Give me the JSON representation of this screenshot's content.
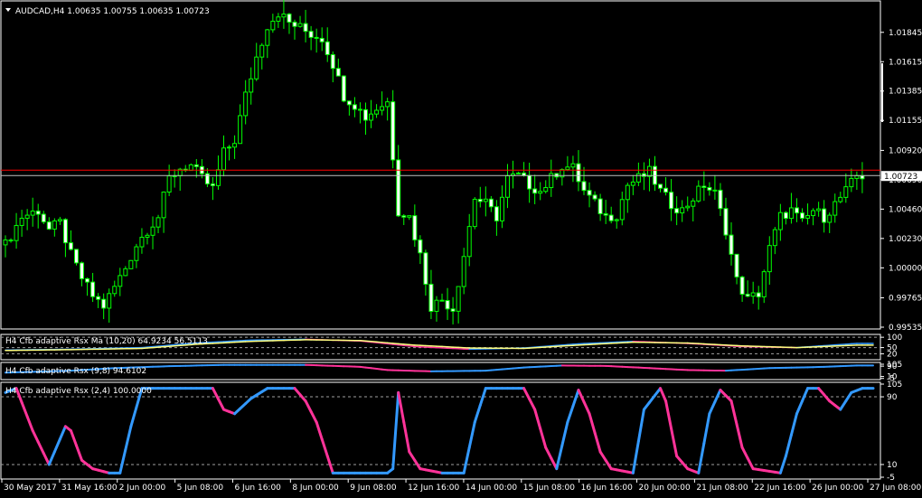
{
  "colors": {
    "background": "#000000",
    "frame": "#ffffff",
    "bull_wick": "#00ff00",
    "bear_wick": "#00ff00",
    "bull_body": "#000000",
    "bear_body": "#ffffff",
    "price_line": "#ff0000",
    "bid_line": "#c0c0c0",
    "rsx_up": "#3399ff",
    "rsx_down": "#ff3399",
    "ma_line": "#ffff80",
    "level_line": "#a0a0a0",
    "price_tag_bg": "#ffffff",
    "price_tag_fg": "#000000"
  },
  "header": {
    "symbol_title": "AUDCAD,H4  1.00635 1.00755 1.00635 1.00723",
    "menu_icon": "triangle-down-icon"
  },
  "chart_data": [
    {
      "type": "candlestick",
      "title": "AUDCAD,H4  1.00635 1.00755 1.00635 1.00723",
      "ylim": [
        0.99535,
        1.0207
      ],
      "y_ticks": [
        "1.01845",
        "1.01615",
        "1.01385",
        "1.01155",
        "1.00920",
        "1.00690",
        "1.00460",
        "1.00230",
        "1.00000",
        "0.99765",
        "0.99535"
      ],
      "y_tick_values": [
        1.01845,
        1.01615,
        1.01385,
        1.01155,
        1.0092,
        1.0069,
        1.0046,
        1.0023,
        1.0,
        0.99765,
        0.99535
      ],
      "current_price_label": "1.00723",
      "current_price": 1.00723,
      "x_tick_labels": [
        "30 May 2017",
        "31 May 16:00",
        "2 Jun 00:00",
        "5 Jun 08:00",
        "6 Jun 16:00",
        "8 Jun 00:00",
        "9 Jun 08:00",
        "12 Jun 16:00",
        "14 Jun 00:00",
        "15 Jun 08:00",
        "16 Jun 16:00",
        "20 Jun 00:00",
        "21 Jun 08:00",
        "22 Jun 16:00",
        "26 Jun 00:00",
        "27 Jun 08:00"
      ],
      "close_anchors": [
        [
          0,
          1.0018
        ],
        [
          3,
          1.004
        ],
        [
          6,
          1.0045
        ],
        [
          8,
          1.003
        ],
        [
          10,
          1.0035
        ],
        [
          12,
          1.001
        ],
        [
          14,
          0.9992
        ],
        [
          16,
          0.9978
        ],
        [
          18,
          0.997
        ],
        [
          20,
          0.9985
        ],
        [
          22,
          1.0
        ],
        [
          24,
          1.0018
        ],
        [
          26,
          1.003
        ],
        [
          28,
          1.004
        ],
        [
          30,
          1.007
        ],
        [
          32,
          1.0078
        ],
        [
          34,
          1.008
        ],
        [
          36,
          1.007
        ],
        [
          38,
          1.0062
        ],
        [
          40,
          1.009
        ],
        [
          42,
          1.01
        ],
        [
          44,
          1.0135
        ],
        [
          46,
          1.0165
        ],
        [
          48,
          1.019
        ],
        [
          50,
          1.02
        ],
        [
          52,
          1.0192
        ],
        [
          54,
          1.0188
        ],
        [
          56,
          1.0183
        ],
        [
          58,
          1.018
        ],
        [
          60,
          1.016
        ],
        [
          62,
          1.0135
        ],
        [
          64,
          1.0128
        ],
        [
          66,
          1.0118
        ],
        [
          68,
          1.0125
        ],
        [
          70,
          1.013
        ],
        [
          72,
          1.0045
        ],
        [
          74,
          1.004
        ],
        [
          76,
          1.001
        ],
        [
          78,
          0.997
        ],
        [
          80,
          0.9975
        ],
        [
          82,
          0.9968
        ],
        [
          84,
          1.001
        ],
        [
          86,
          1.0055
        ],
        [
          88,
          1.005
        ],
        [
          90,
          1.004
        ],
        [
          92,
          1.007
        ],
        [
          94,
          1.0072
        ],
        [
          96,
          1.0065
        ],
        [
          98,
          1.006
        ],
        [
          100,
          1.007
        ],
        [
          102,
          1.008
        ],
        [
          104,
          1.0078
        ],
        [
          106,
          1.006
        ],
        [
          108,
          1.005
        ],
        [
          110,
          1.004
        ],
        [
          112,
          1.0042
        ],
        [
          114,
          1.0065
        ],
        [
          116,
          1.007
        ],
        [
          118,
          1.0075
        ],
        [
          120,
          1.006
        ],
        [
          122,
          1.005
        ],
        [
          124,
          1.0045
        ],
        [
          126,
          1.0055
        ],
        [
          128,
          1.0065
        ],
        [
          130,
          1.0058
        ],
        [
          132,
          1.003
        ],
        [
          134,
          0.999
        ],
        [
          136,
          0.9975
        ],
        [
          138,
          0.998
        ],
        [
          140,
          1.0015
        ],
        [
          142,
          1.004
        ],
        [
          144,
          1.0045
        ],
        [
          146,
          1.0035
        ],
        [
          148,
          1.0045
        ],
        [
          150,
          1.004
        ],
        [
          152,
          1.005
        ],
        [
          154,
          1.006
        ],
        [
          156,
          1.0072
        ]
      ]
    },
    {
      "type": "line",
      "title": "H4 Cfb adaptive Rsx Ma (10,20) 64.9234 56.5113",
      "ylim": [
        0,
        105
      ],
      "y_ticks": [
        "100",
        "50",
        "20"
      ],
      "y_tick_values": [
        100,
        50,
        20
      ],
      "levels": [
        50,
        20,
        100
      ],
      "series": [
        {
          "name": "Rsx Ma fast",
          "anchors": [
            [
              0,
              38
            ],
            [
              12,
              42
            ],
            [
              25,
              50
            ],
            [
              35,
              72
            ],
            [
              45,
              86
            ],
            [
              55,
              90
            ],
            [
              65,
              82
            ],
            [
              75,
              55
            ],
            [
              85,
              42
            ],
            [
              95,
              48
            ],
            [
              105,
              68
            ],
            [
              115,
              80
            ],
            [
              125,
              70
            ],
            [
              135,
              55
            ],
            [
              145,
              50
            ],
            [
              156,
              70
            ]
          ]
        },
        {
          "name": "Rsx Ma slow",
          "anchors": [
            [
              0,
              36
            ],
            [
              12,
              40
            ],
            [
              25,
              46
            ],
            [
              35,
              66
            ],
            [
              45,
              80
            ],
            [
              55,
              88
            ],
            [
              65,
              84
            ],
            [
              75,
              62
            ],
            [
              85,
              48
            ],
            [
              95,
              46
            ],
            [
              105,
              62
            ],
            [
              115,
              76
            ],
            [
              125,
              72
            ],
            [
              135,
              58
            ],
            [
              145,
              50
            ],
            [
              156,
              62
            ]
          ]
        }
      ]
    },
    {
      "type": "line",
      "title": "H4 Cfb adaptive Rsx (9,8) 94.6102",
      "ylim": [
        0,
        105
      ],
      "y_ticks": [
        "105",
        "90",
        "10",
        "-5"
      ],
      "y_tick_values": [
        105,
        90,
        10,
        -5
      ],
      "series": [
        {
          "name": "Rsx (9,8)",
          "anchors": [
            [
              0,
              40
            ],
            [
              12,
              55
            ],
            [
              20,
              75
            ],
            [
              30,
              90
            ],
            [
              40,
              100
            ],
            [
              55,
              100
            ],
            [
              65,
              85
            ],
            [
              70,
              60
            ],
            [
              78,
              50
            ],
            [
              88,
              55
            ],
            [
              95,
              80
            ],
            [
              102,
              95
            ],
            [
              110,
              92
            ],
            [
              118,
              75
            ],
            [
              125,
              60
            ],
            [
              132,
              55
            ],
            [
              140,
              75
            ],
            [
              148,
              82
            ],
            [
              156,
              95
            ]
          ]
        }
      ]
    },
    {
      "type": "line",
      "title": "H4 Cfb adaptive Rsx (2,4) 100.0000",
      "ylim": [
        -5,
        105
      ],
      "y_ticks": [
        "105",
        "90",
        "10",
        "-5"
      ],
      "y_tick_values": [
        105,
        90,
        10,
        -5
      ],
      "levels": [
        90,
        10
      ],
      "series": [
        {
          "name": "Rsx (2,4)",
          "anchors": [
            [
              0,
              95
            ],
            [
              2,
              100
            ],
            [
              5,
              50
            ],
            [
              8,
              10
            ],
            [
              11,
              55
            ],
            [
              12,
              50
            ],
            [
              14,
              15
            ],
            [
              16,
              5
            ],
            [
              19,
              0
            ],
            [
              21,
              0
            ],
            [
              23,
              55
            ],
            [
              25,
              100
            ],
            [
              28,
              100
            ],
            [
              31,
              100
            ],
            [
              37,
              100
            ],
            [
              38,
              100
            ],
            [
              40,
              75
            ],
            [
              42,
              70
            ],
            [
              45,
              88
            ],
            [
              48,
              100
            ],
            [
              53,
              100
            ],
            [
              55,
              85
            ],
            [
              57,
              60
            ],
            [
              59,
              20
            ],
            [
              60,
              0
            ],
            [
              65,
              0
            ],
            [
              70,
              0
            ],
            [
              71,
              5
            ],
            [
              72,
              95
            ],
            [
              74,
              25
            ],
            [
              76,
              5
            ],
            [
              80,
              0
            ],
            [
              84,
              0
            ],
            [
              86,
              60
            ],
            [
              88,
              100
            ],
            [
              95,
              100
            ],
            [
              97,
              75
            ],
            [
              99,
              30
            ],
            [
              101,
              5
            ],
            [
              103,
              60
            ],
            [
              105,
              98
            ],
            [
              107,
              70
            ],
            [
              109,
              25
            ],
            [
              111,
              5
            ],
            [
              115,
              0
            ],
            [
              117,
              75
            ],
            [
              120,
              100
            ],
            [
              121,
              85
            ],
            [
              123,
              20
            ],
            [
              125,
              5
            ],
            [
              127,
              0
            ],
            [
              129,
              70
            ],
            [
              131,
              98
            ],
            [
              133,
              85
            ],
            [
              135,
              30
            ],
            [
              137,
              5
            ],
            [
              142,
              0
            ],
            [
              143,
              20
            ],
            [
              145,
              70
            ],
            [
              147,
              100
            ],
            [
              149,
              100
            ],
            [
              151,
              85
            ],
            [
              153,
              75
            ],
            [
              155,
              95
            ],
            [
              157,
              100
            ],
            [
              159,
              100
            ]
          ]
        }
      ]
    }
  ]
}
